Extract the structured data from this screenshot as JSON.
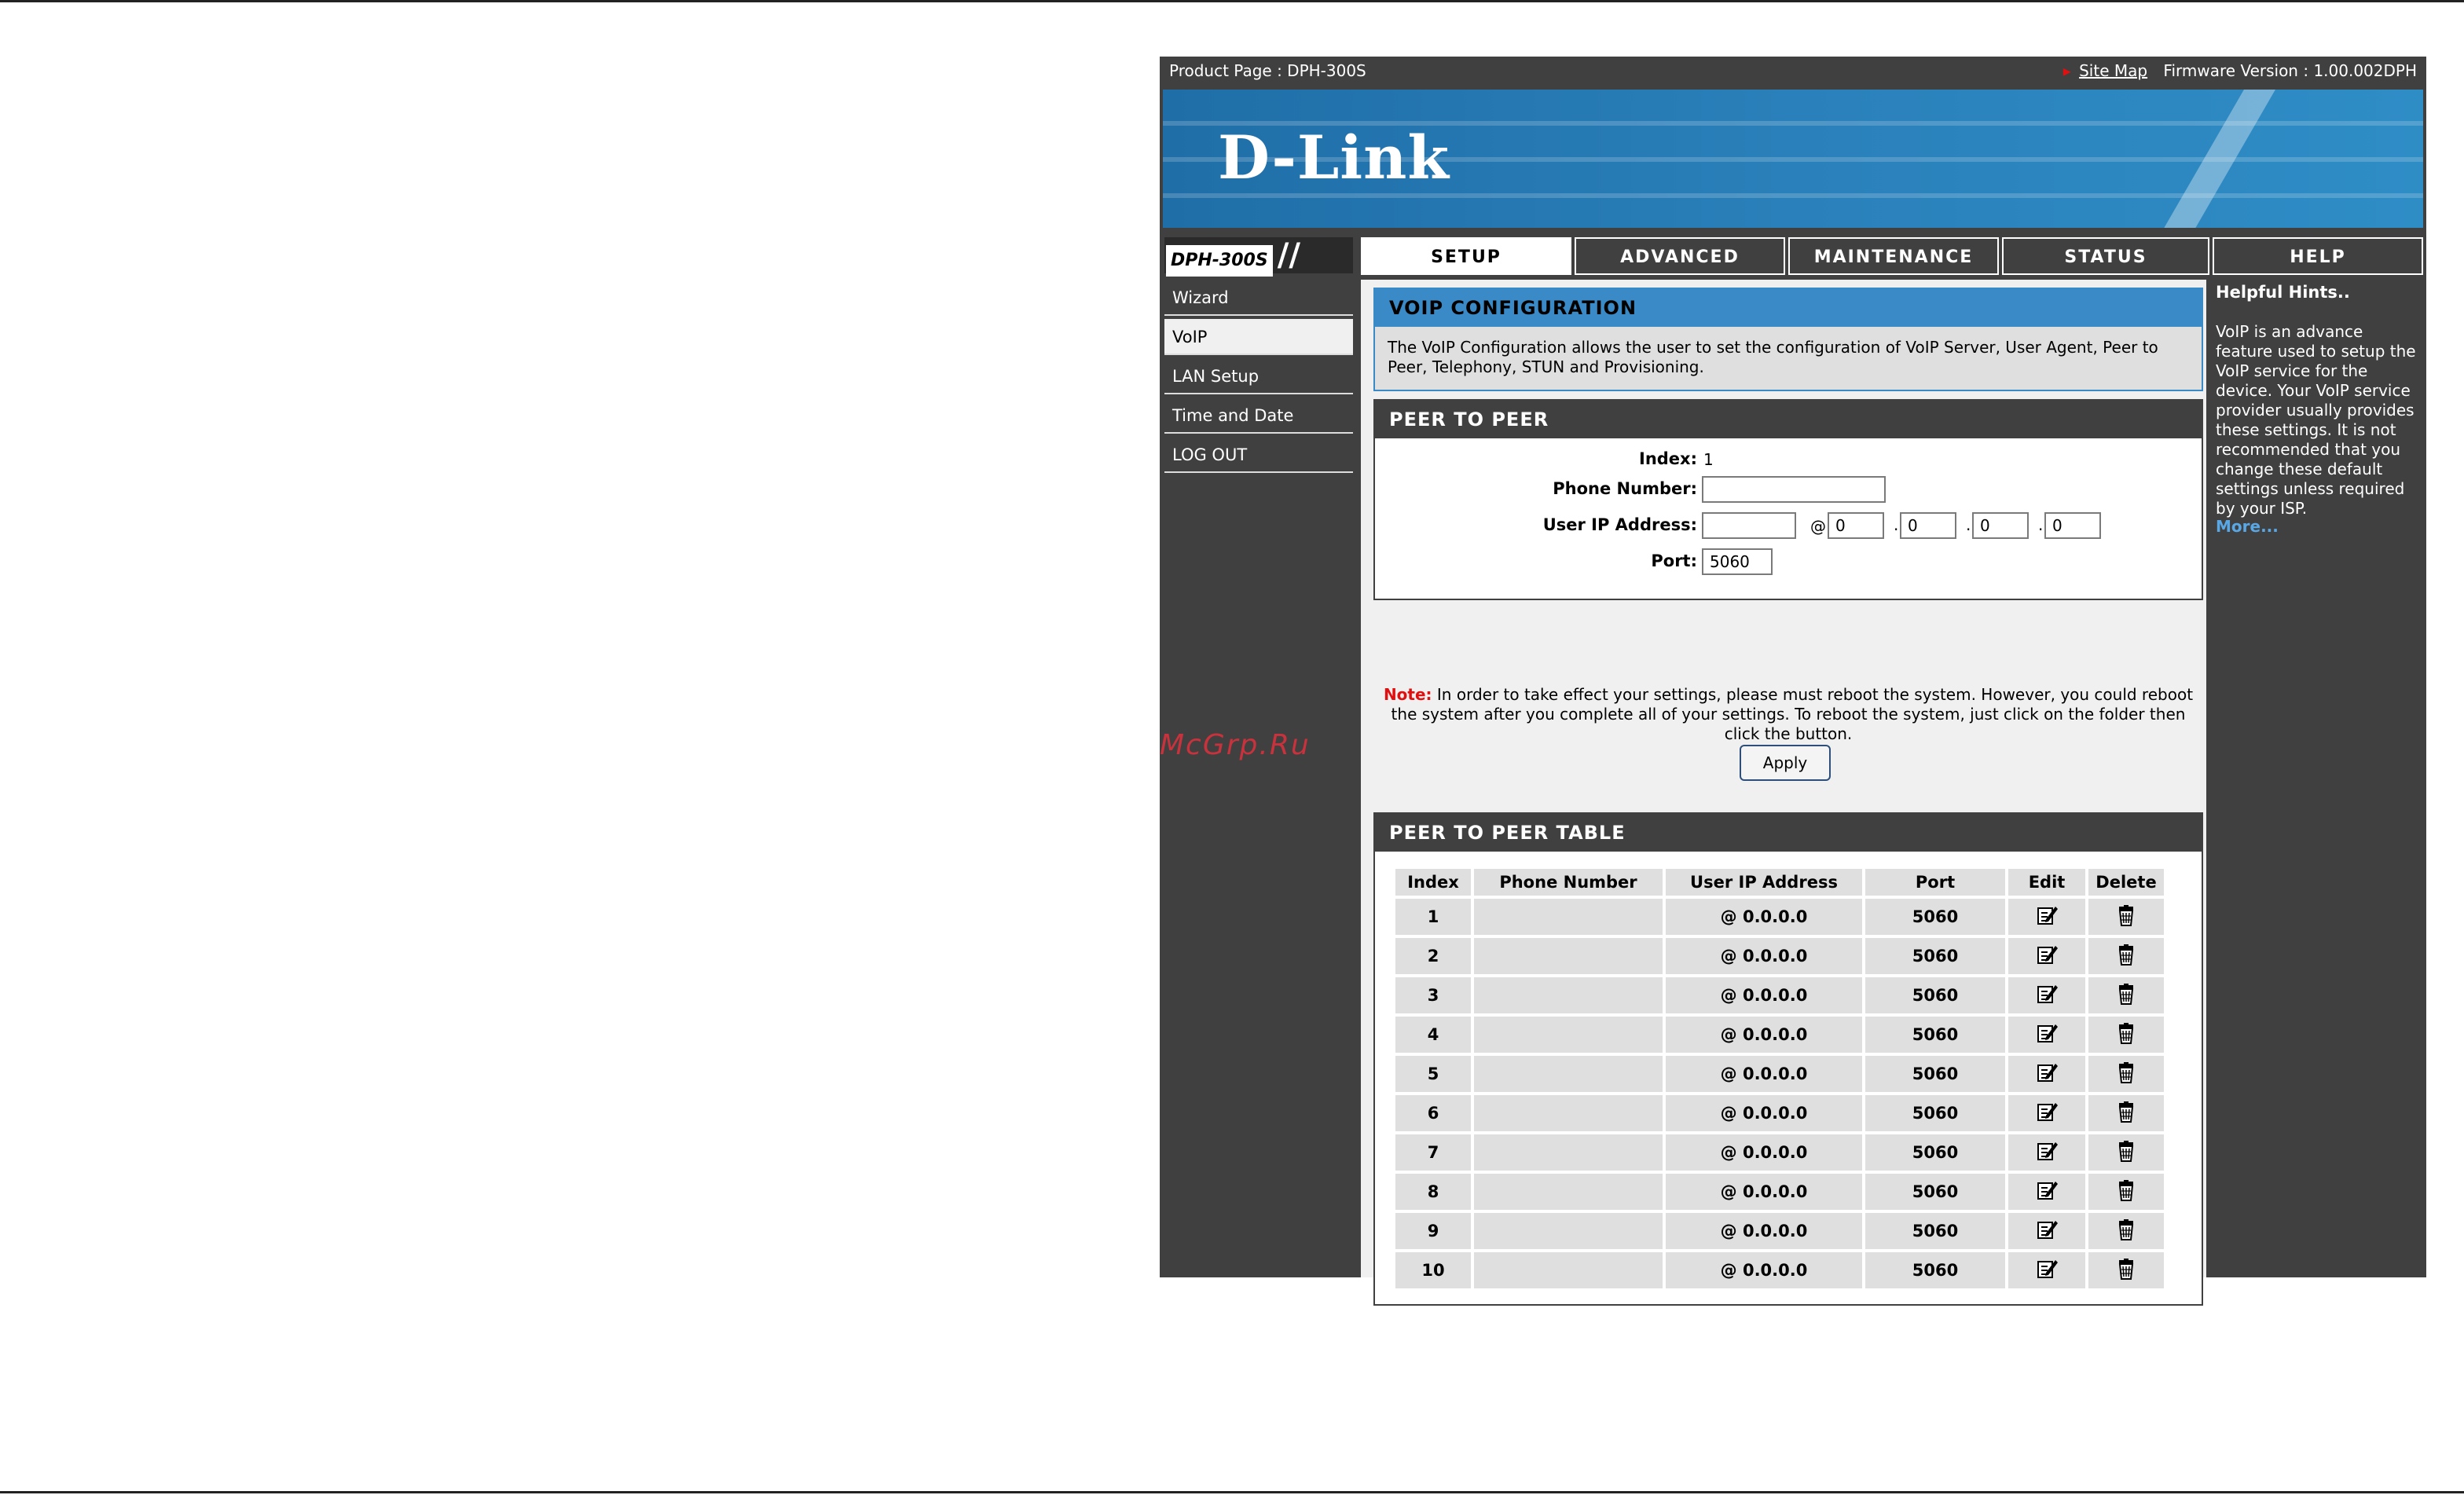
{
  "topbar": {
    "product_label": "Product Page :  DPH-300S",
    "site_map": "Site Map",
    "firmware": "Firmware Version :   1.00.002DPH"
  },
  "logo": "D-Link",
  "model": "DPH-300S",
  "tabs": [
    {
      "label": "SETUP",
      "active": true
    },
    {
      "label": "ADVANCED",
      "active": false
    },
    {
      "label": "MAINTENANCE",
      "active": false
    },
    {
      "label": "STATUS",
      "active": false
    },
    {
      "label": "HELP",
      "active": false
    }
  ],
  "sidebar": {
    "items": [
      {
        "label": "Wizard"
      },
      {
        "label": "VoIP"
      },
      {
        "label": "LAN Setup"
      },
      {
        "label": "Time and Date"
      },
      {
        "label": "LOG OUT"
      }
    ]
  },
  "voip": {
    "title": "VOIP CONFIGURATION",
    "description": "The VoIP Configuration allows the user to set the configuration of VoIP Server, User Agent, Peer to Peer, Telephony, STUN and Provisioning."
  },
  "p2p": {
    "title": "PEER TO PEER",
    "index_label": "Index:",
    "index_value": "1",
    "phone_label": "Phone Number:",
    "phone_value": "",
    "ip_label": "User IP Address:",
    "user_value": "",
    "at": "@",
    "octets": [
      "0",
      "0",
      "0",
      "0"
    ],
    "dot": ".",
    "port_label": "Port:",
    "port_value": "5060"
  },
  "note": {
    "label": "Note:",
    "text": " In order to take effect your settings, please must reboot the system. However, you could reboot the system after you complete all of your settings. To reboot the system, just click on the folder then click the button."
  },
  "apply_label": "Apply",
  "table": {
    "title": "PEER TO PEER TABLE",
    "headers": [
      "Index",
      "Phone Number",
      "User IP Address",
      "Port",
      "Edit",
      "Delete"
    ],
    "rows": [
      {
        "index": "1",
        "phone": "",
        "ip": "@ 0.0.0.0",
        "port": "5060"
      },
      {
        "index": "2",
        "phone": "",
        "ip": "@ 0.0.0.0",
        "port": "5060"
      },
      {
        "index": "3",
        "phone": "",
        "ip": "@ 0.0.0.0",
        "port": "5060"
      },
      {
        "index": "4",
        "phone": "",
        "ip": "@ 0.0.0.0",
        "port": "5060"
      },
      {
        "index": "5",
        "phone": "",
        "ip": "@ 0.0.0.0",
        "port": "5060"
      },
      {
        "index": "6",
        "phone": "",
        "ip": "@ 0.0.0.0",
        "port": "5060"
      },
      {
        "index": "7",
        "phone": "",
        "ip": "@ 0.0.0.0",
        "port": "5060"
      },
      {
        "index": "8",
        "phone": "",
        "ip": "@ 0.0.0.0",
        "port": "5060"
      },
      {
        "index": "9",
        "phone": "",
        "ip": "@ 0.0.0.0",
        "port": "5060"
      },
      {
        "index": "10",
        "phone": "",
        "ip": "@ 0.0.0.0",
        "port": "5060"
      }
    ]
  },
  "hints": {
    "title": "Helpful Hints..",
    "body": "VoIP is an advance feature used to setup the VoIP service for the device. Your VoIP service provider usually provides these settings. It is not recommended that you change these default settings unless required by your ISP.",
    "more": "More..."
  },
  "watermark": "McGrp.Ru",
  "icons": {
    "edit": "edit-icon",
    "delete": "trash-icon"
  }
}
